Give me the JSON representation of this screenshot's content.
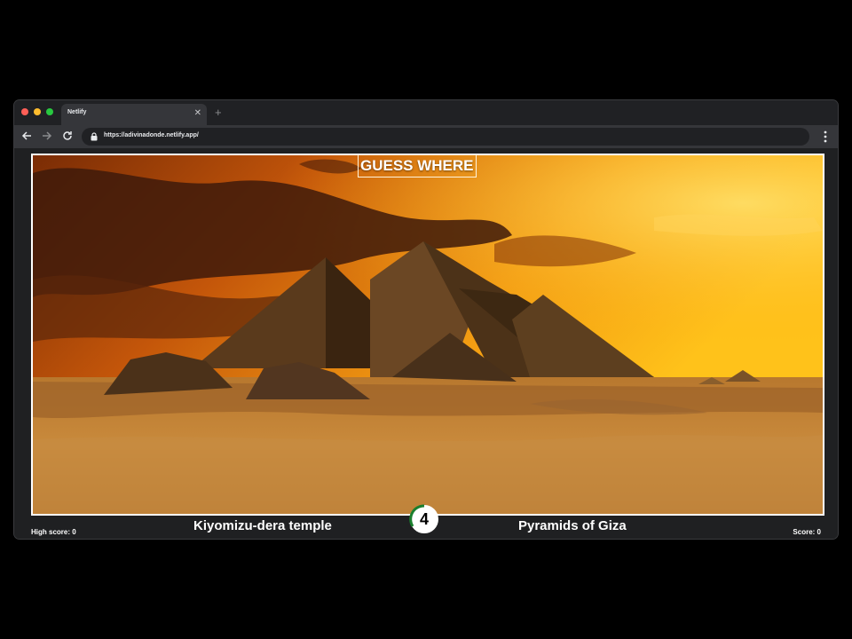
{
  "browser": {
    "tab_title": "Netlify",
    "tab_close_icon": "close-icon",
    "new_tab_icon": "plus-icon",
    "url": "https://adivinadonde.netlify.app/"
  },
  "game": {
    "title": "GUESS WHERE",
    "high_score_label": "High score: 0",
    "score_label": "Score: 0",
    "options": [
      "Kiyomizu-dera temple",
      "Pyramids of Giza"
    ],
    "timer": "4"
  },
  "colors": {
    "window_bg": "#202124",
    "toolbar_bg": "#35363a",
    "timer_ring": "#1a7f2e"
  }
}
